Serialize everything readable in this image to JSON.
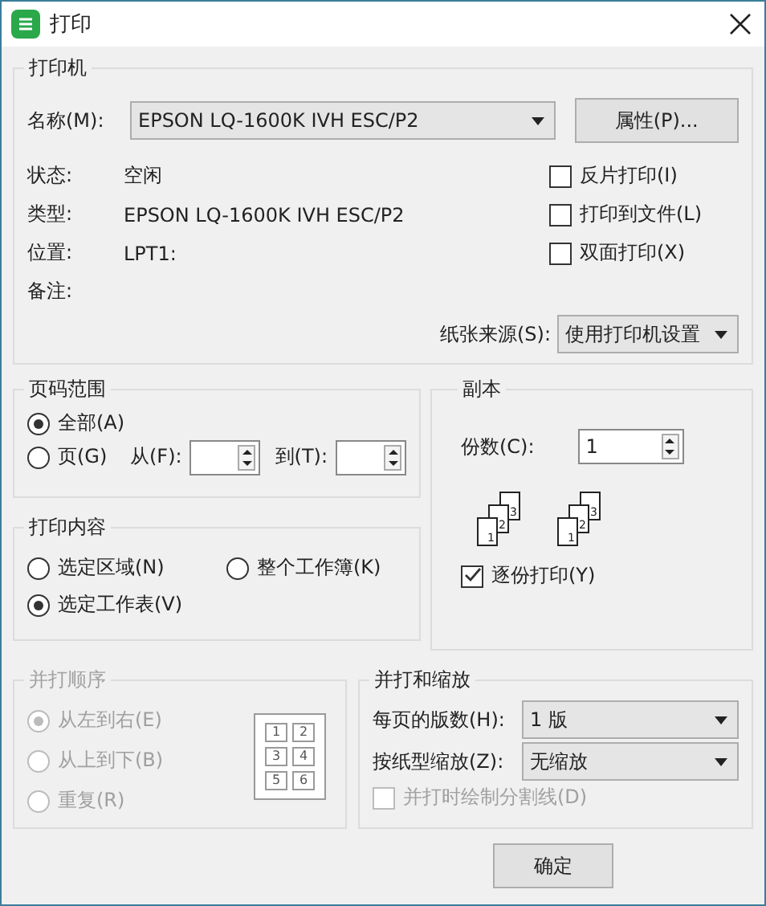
{
  "window": {
    "title": "打印"
  },
  "printer": {
    "legend": "打印机",
    "name_label": "名称(M):",
    "name_value": "EPSON LQ-1600K IVH ESC/P2",
    "properties_button": "属性(P)...",
    "info": [
      {
        "label": "状态:",
        "value": "空闲"
      },
      {
        "label": "类型:",
        "value": "EPSON LQ-1600K IVH ESC/P2"
      },
      {
        "label": "位置:",
        "value": "LPT1:"
      },
      {
        "label": "备注:"
      }
    ],
    "options": [
      {
        "label": "反片打印(I)",
        "checked": false
      },
      {
        "label": "打印到文件(L)",
        "checked": false
      },
      {
        "label": "双面打印(X)",
        "checked": false
      }
    ],
    "paper_source_label": "纸张来源(S):",
    "paper_source_value": "使用打印机设置"
  },
  "page_range": {
    "legend": "页码范围",
    "options": [
      {
        "label": "全部(A)",
        "selected": true
      },
      {
        "label": "页(G)",
        "selected": false
      }
    ],
    "from_label": "从(F):",
    "to_label": "到(T):"
  },
  "copies": {
    "legend": "副本",
    "count_label": "份数(C):",
    "count_value": "1",
    "collate_icons": [
      {
        "pages": [
          "1",
          "2",
          "3"
        ]
      },
      {
        "pages": [
          "1",
          "2",
          "3"
        ]
      }
    ],
    "collate_label": "逐份打印(Y)",
    "collate_checked": true
  },
  "print_content": {
    "legend": "打印内容",
    "options": [
      {
        "label": "选定区域(N)",
        "selected": false
      },
      {
        "label": "整个工作簿(K)",
        "selected": false
      },
      {
        "label": "选定工作表(V)",
        "selected": true
      }
    ]
  },
  "order": {
    "legend": "并打顺序",
    "disabled": true,
    "options": [
      {
        "label": "从左到右(E)",
        "selected": true
      },
      {
        "label": "从上到下(B)",
        "selected": false
      },
      {
        "label": "重复(R)",
        "selected": false
      }
    ],
    "layout_pages": [
      "1",
      "2",
      "3",
      "4",
      "5",
      "6"
    ]
  },
  "scaling": {
    "legend": "并打和缩放",
    "rows": [
      {
        "label": "每页的版数(H):",
        "value": "1 版"
      },
      {
        "label": "按纸型缩放(Z):",
        "value": "无缩放"
      }
    ],
    "divider_option": {
      "label": "并打时绘制分割线(D)",
      "checked": false,
      "disabled": true
    }
  },
  "buttons": [
    "确定"
  ]
}
